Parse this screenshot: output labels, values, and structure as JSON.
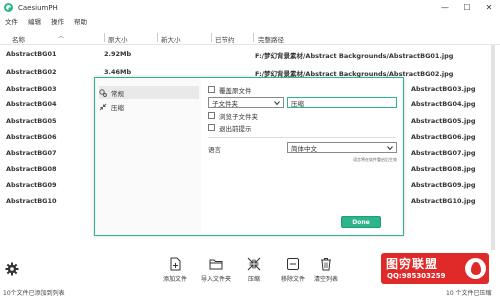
{
  "window": {
    "title": "CaesiumPH",
    "minimize": "—",
    "maximize": "☐",
    "close": "✕"
  },
  "menu": [
    "文件",
    "编辑",
    "操作",
    "帮助"
  ],
  "columns": {
    "name": "名称",
    "original_size": "原大小",
    "new_size": "新大小",
    "saved": "已节约",
    "full_path": "完整路径"
  },
  "rows": [
    {
      "name": "AbstractBG01",
      "size": "2.92Mb",
      "path": "F:/梦幻背景素材/Abstract Backgrounds/AbstractBG01.jpg"
    },
    {
      "name": "AbstractBG02",
      "size": "3.46Mb",
      "path": "F:/梦幻背景素材/Abstract Backgrounds/AbstractBG02.jpg"
    },
    {
      "name": "AbstractBG03",
      "size": "",
      "path": "AbstractBG03.jpg"
    },
    {
      "name": "AbstractBG04",
      "size": "",
      "path": "AbstractBG04.jpg"
    },
    {
      "name": "AbstractBG05",
      "size": "",
      "path": "AbstractBG05.jpg"
    },
    {
      "name": "AbstractBG06",
      "size": "",
      "path": "AbstractBG06.jpg"
    },
    {
      "name": "AbstractBG07",
      "size": "",
      "path": "AbstractBG07.jpg"
    },
    {
      "name": "AbstractBG08",
      "size": "",
      "path": "AbstractBG08.jpg"
    },
    {
      "name": "AbstractBG09",
      "size": "",
      "path": "AbstractBG09.jpg"
    },
    {
      "name": "AbstractBG10",
      "size": "",
      "path": "AbstractBG10.jpg"
    }
  ],
  "toolbar": {
    "add_file": "添加文件",
    "import_folder": "导入文件夹",
    "compress": "压缩",
    "remove_files": "移除文件",
    "clear_list": "清空列表"
  },
  "status": {
    "left": "10个文件已添加到列表",
    "right": "10 个文件已压缩"
  },
  "watermark": {
    "title": "图穷联盟",
    "qq": "QQ:985303259"
  },
  "dialog": {
    "nav": [
      {
        "label": "常规",
        "icon": "gears-icon"
      },
      {
        "label": "压缩",
        "icon": "compress-arrows-icon"
      }
    ],
    "overwrite_label": "覆盖原文件",
    "subfolder_option": "子文件夹",
    "subfolder_name": "压缩",
    "include_subfolders_label": "浏览子文件夹",
    "exit_prompt_label": "退出前提示",
    "language_label": "语言",
    "language_value": "简体中文",
    "restart_hint": "语言将在软件重启后生效",
    "done_label": "Done"
  },
  "colors": {
    "accent": "#2bb58a",
    "watermark": "#e02a2a"
  }
}
